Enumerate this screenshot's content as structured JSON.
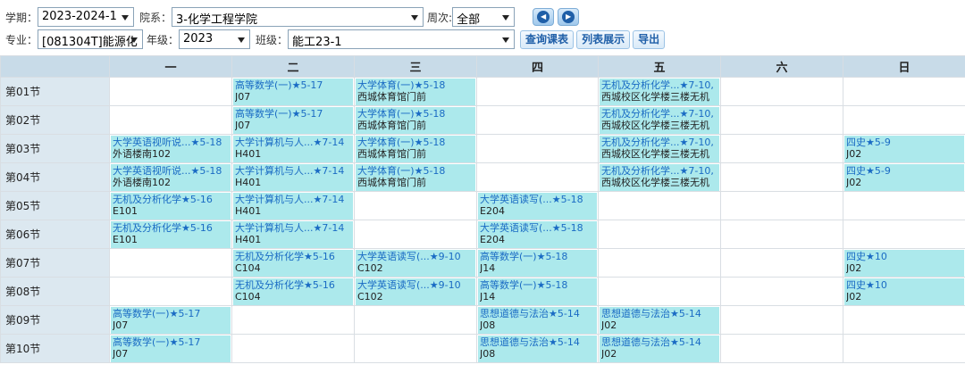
{
  "filters": {
    "term_label": "学期：",
    "term_value": "2023-2024-1",
    "dept_label": "院系：",
    "dept_value": "3-化学工程学院",
    "week_label": "周次:",
    "week_value": "全部",
    "major_label": "专业：",
    "major_value": "[081304T]能源化",
    "grade_label": "年级：",
    "grade_value": "2023",
    "class_label": "班级：",
    "class_value": "能工23-1",
    "query_button": "查询课表",
    "list_button": "列表展示",
    "export_button": "导出"
  },
  "days": [
    "一",
    "二",
    "三",
    "四",
    "五",
    "六",
    "日"
  ],
  "rows": [
    {
      "label": "第01节",
      "cells": [
        null,
        {
          "name": "高等数学(一)★5-17",
          "loc": "J07"
        },
        {
          "name": "大学体育(一)★5-18",
          "loc": "西城体育馆门前"
        },
        null,
        {
          "name": "无机及分析化学...★7-10,",
          "loc": "西城校区化学楼三楼无机"
        },
        null,
        null
      ]
    },
    {
      "label": "第02节",
      "cells": [
        null,
        {
          "name": "高等数学(一)★5-17",
          "loc": "J07"
        },
        {
          "name": "大学体育(一)★5-18",
          "loc": "西城体育馆门前"
        },
        null,
        {
          "name": "无机及分析化学...★7-10,",
          "loc": "西城校区化学楼三楼无机"
        },
        null,
        null
      ]
    },
    {
      "label": "第03节",
      "cells": [
        {
          "name": "大学英语视听说...★5-18",
          "loc": "外语楼南102"
        },
        {
          "name": "大学计算机与人...★7-14",
          "loc": "H401"
        },
        {
          "name": "大学体育(一)★5-18",
          "loc": "西城体育馆门前"
        },
        null,
        {
          "name": "无机及分析化学...★7-10,",
          "loc": "西城校区化学楼三楼无机"
        },
        null,
        {
          "name": "四史★5-9",
          "loc": "J02"
        }
      ]
    },
    {
      "label": "第04节",
      "cells": [
        {
          "name": "大学英语视听说...★5-18",
          "loc": "外语楼南102"
        },
        {
          "name": "大学计算机与人...★7-14",
          "loc": "H401"
        },
        {
          "name": "大学体育(一)★5-18",
          "loc": "西城体育馆门前"
        },
        null,
        {
          "name": "无机及分析化学...★7-10,",
          "loc": "西城校区化学楼三楼无机"
        },
        null,
        {
          "name": "四史★5-9",
          "loc": "J02"
        }
      ]
    },
    {
      "label": "第05节",
      "cells": [
        {
          "name": "无机及分析化学★5-16",
          "loc": "E101"
        },
        {
          "name": "大学计算机与人...★7-14",
          "loc": "H401"
        },
        null,
        {
          "name": "大学英语读写(...★5-18",
          "loc": "E204"
        },
        null,
        null,
        null
      ]
    },
    {
      "label": "第06节",
      "cells": [
        {
          "name": "无机及分析化学★5-16",
          "loc": "E101"
        },
        {
          "name": "大学计算机与人...★7-14",
          "loc": "H401"
        },
        null,
        {
          "name": "大学英语读写(...★5-18",
          "loc": "E204"
        },
        null,
        null,
        null
      ]
    },
    {
      "label": "第07节",
      "cells": [
        null,
        {
          "name": "无机及分析化学★5-16",
          "loc": "C104"
        },
        {
          "name": "大学英语读写(...★9-10",
          "loc": "C102"
        },
        {
          "name": "高等数学(一)★5-18",
          "loc": "J14"
        },
        null,
        null,
        {
          "name": "四史★10",
          "loc": "J02"
        }
      ]
    },
    {
      "label": "第08节",
      "cells": [
        null,
        {
          "name": "无机及分析化学★5-16",
          "loc": "C104"
        },
        {
          "name": "大学英语读写(...★9-10",
          "loc": "C102"
        },
        {
          "name": "高等数学(一)★5-18",
          "loc": "J14"
        },
        null,
        null,
        {
          "name": "四史★10",
          "loc": "J02"
        }
      ]
    },
    {
      "label": "第09节",
      "cells": [
        {
          "name": "高等数学(一)★5-17",
          "loc": "J07"
        },
        null,
        null,
        {
          "name": "思想道德与法治★5-14",
          "loc": "J08"
        },
        {
          "name": "思想道德与法治★5-14",
          "loc": "J02"
        },
        null,
        null
      ]
    },
    {
      "label": "第10节",
      "cells": [
        {
          "name": "高等数学(一)★5-17",
          "loc": "J07"
        },
        null,
        null,
        {
          "name": "思想道德与法治★5-14",
          "loc": "J08"
        },
        {
          "name": "思想道德与法治★5-14",
          "loc": "J02"
        },
        null,
        null
      ]
    }
  ]
}
